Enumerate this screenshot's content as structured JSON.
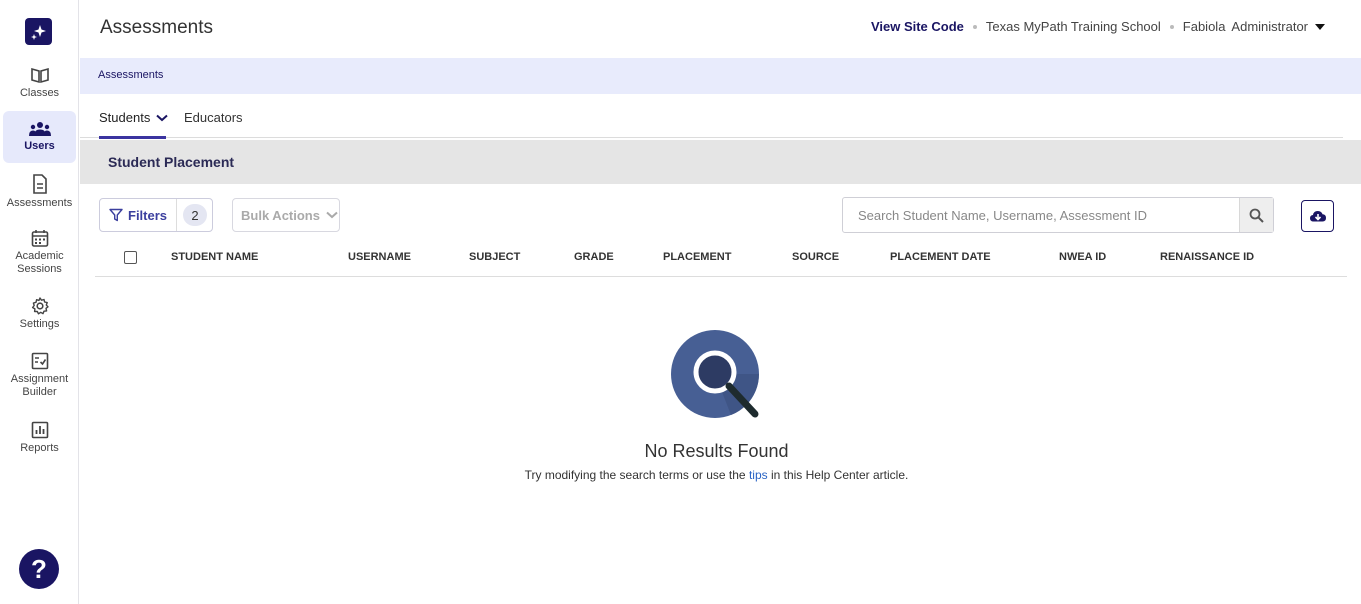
{
  "header": {
    "title": "Assessments",
    "site_code_link": "View Site Code",
    "school": "Texas MyPath Training School",
    "user_name": "Fabiola",
    "user_role": "Administrator"
  },
  "breadcrumb": "Assessments",
  "sidebar": {
    "items": [
      {
        "label": "Classes",
        "icon": "open-book-icon"
      },
      {
        "label": "Users",
        "icon": "users-icon",
        "active": true
      },
      {
        "label": "Assessments",
        "icon": "document-icon"
      },
      {
        "label": "Academic Sessions",
        "icon": "calendar-icon"
      },
      {
        "label": "Settings",
        "icon": "gear-icon"
      },
      {
        "label": "Assignment Builder",
        "icon": "checklist-icon"
      },
      {
        "label": "Reports",
        "icon": "bar-chart-icon"
      }
    ],
    "help": "?"
  },
  "tabs": [
    {
      "label": "Students",
      "active": true
    },
    {
      "label": "Educators",
      "active": false
    }
  ],
  "section_title": "Student Placement",
  "toolbar": {
    "filters_label": "Filters",
    "filters_count": "2",
    "bulk_actions_label": "Bulk Actions",
    "search_placeholder": "Search Student Name, Username, Assessment ID"
  },
  "table": {
    "columns": [
      "STUDENT NAME",
      "USERNAME",
      "SUBJECT",
      "GRADE",
      "PLACEMENT",
      "SOURCE",
      "PLACEMENT DATE",
      "NWEA ID",
      "RENAISSANCE ID"
    ],
    "rows": []
  },
  "empty_state": {
    "title": "No Results Found",
    "message_before": "Try modifying the search terms or use the ",
    "link_text": "tips",
    "message_after": " in this Help Center article."
  },
  "colors": {
    "brand": "#1a1563",
    "accent": "#3b34a0",
    "breadcrumb_bg": "#e8ebfc",
    "link": "#2a64c5"
  }
}
